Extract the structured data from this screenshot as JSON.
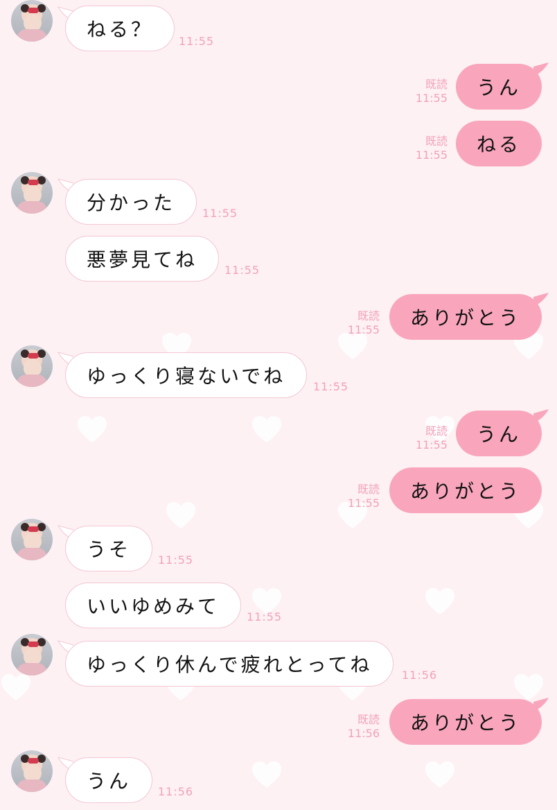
{
  "colors": {
    "background": "#fdf1f4",
    "incoming_bubble": "#ffffff",
    "outgoing_bubble": "#f9a6bd",
    "meta_text": "#f2a1b9",
    "message_text": "#111111"
  },
  "read_label": "既読",
  "messages": [
    {
      "side": "in",
      "text": "ねる？",
      "time": "11:55"
    },
    {
      "side": "out",
      "text": "うん",
      "time": "11:55",
      "read": true
    },
    {
      "side": "out",
      "text": "ねる",
      "time": "11:55",
      "read": true
    },
    {
      "side": "in",
      "text": "分かった",
      "time": "11:55"
    },
    {
      "side": "in",
      "text": "悪夢見てね",
      "time": "11:55"
    },
    {
      "side": "out",
      "text": "ありがとう",
      "time": "11:55",
      "read": true
    },
    {
      "side": "in",
      "text": "ゆっくり寝ないでね",
      "time": "11:55"
    },
    {
      "side": "out",
      "text": "うん",
      "time": "11:55",
      "read": true
    },
    {
      "side": "out",
      "text": "ありがとう",
      "time": "11:55",
      "read": true
    },
    {
      "side": "in",
      "text": "うそ",
      "time": "11:55"
    },
    {
      "side": "in",
      "text": "いいゆめみて",
      "time": "11:55"
    },
    {
      "side": "in",
      "text": "ゆっくり休んで疲れとってね",
      "time": "11:56"
    },
    {
      "side": "out",
      "text": "ありがとう",
      "time": "11:56",
      "read": true
    },
    {
      "side": "in",
      "text": "うん",
      "time": "11:56"
    }
  ]
}
